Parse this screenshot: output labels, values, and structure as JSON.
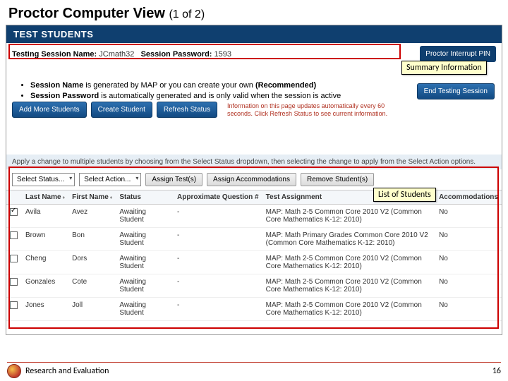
{
  "slide": {
    "title": "Proctor Computer View",
    "counter": "(1 of 2)"
  },
  "header": {
    "title": "TEST STUDENTS"
  },
  "session": {
    "name_label": "Testing Session Name:",
    "name_value": "JCmath32",
    "pwd_label": "Session Password:",
    "pwd_value": "1593",
    "pin_label": "Proctor Interrupt PIN"
  },
  "callouts": {
    "summary": "Summary Information",
    "list": "List of Students"
  },
  "bullets": {
    "b1_pre": "Session Name",
    "b1_rest": " is generated by MAP or you can create your own ",
    "b1_rec": "(Recommended)",
    "b2_pre": "Session Password",
    "b2_rest": " is automatically generated and is only valid when the session is active"
  },
  "buttons": {
    "end": "End Testing Session",
    "add": "Add More Students",
    "create": "Create Student",
    "refresh": "Refresh Status",
    "assign_test": "Assign Test(s)",
    "assign_accom": "Assign Accommodations",
    "remove": "Remove Student(s)"
  },
  "autonote": "Information on this page updates automatically every 60 seconds. Click Refresh Status to see current information.",
  "instr": "Apply a change to multiple students by choosing from the Select Status dropdown, then selecting the change to apply from the Select Action options.",
  "dd": {
    "status": "Select Status...",
    "action": "Select Action..."
  },
  "cols": {
    "cb": "",
    "last": "Last Name",
    "first": "First Name",
    "status": "Status",
    "approx": "Approximate Question #",
    "assign": "Test Assignment",
    "accom": "Accommodations"
  },
  "rows": [
    {
      "checked": true,
      "last": "Avila",
      "first": "Avez",
      "status": "Awaiting Student",
      "approx": "-",
      "assign": "MAP: Math 2-5 Common Core 2010 V2 (Common Core Mathematics K-12: 2010)",
      "accom": "No"
    },
    {
      "checked": false,
      "last": "Brown",
      "first": "Bon",
      "status": "Awaiting Student",
      "approx": "-",
      "assign": "MAP: Math Primary Grades Common Core 2010 V2 (Common Core Mathematics K-12: 2010)",
      "accom": "No"
    },
    {
      "checked": false,
      "last": "Cheng",
      "first": "Dors",
      "status": "Awaiting Student",
      "approx": "-",
      "assign": "MAP: Math 2-5 Common Core 2010 V2 (Common Core Mathematics K-12: 2010)",
      "accom": "No"
    },
    {
      "checked": false,
      "last": "Gonzales",
      "first": "Cote",
      "status": "Awaiting Student",
      "approx": "-",
      "assign": "MAP: Math 2-5 Common Core 2010 V2 (Common Core Mathematics K-12: 2010)",
      "accom": "No"
    },
    {
      "checked": false,
      "last": "Jones",
      "first": "Joll",
      "status": "Awaiting Student",
      "approx": "-",
      "assign": "MAP: Math 2-5 Common Core 2010 V2 (Common Core Mathematics K-12: 2010)",
      "accom": "No"
    }
  ],
  "footer": {
    "org": "Research and Evaluation",
    "page": "16"
  }
}
